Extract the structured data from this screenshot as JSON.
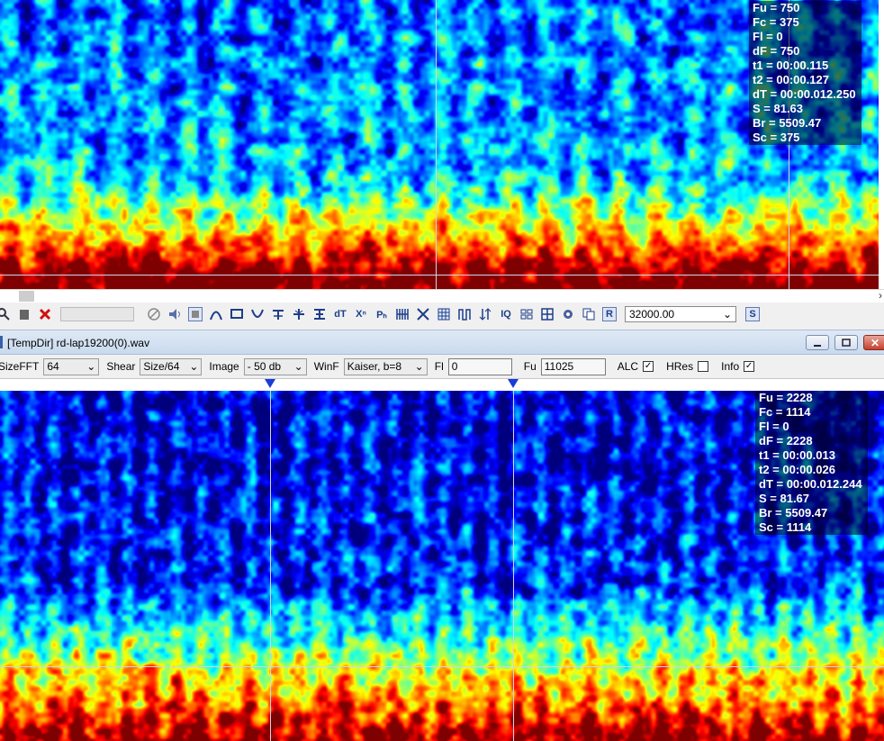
{
  "top_panel": {
    "info": {
      "fu": "Fu = 750",
      "fc": "Fc = 375",
      "fl": "Fl = 0",
      "df": "dF = 750",
      "t1": "t1 = 00:00.115",
      "t2": "t2 = 00:00.127",
      "dt": "dT = 00:00.012.250",
      "s": "S = 81.63",
      "br": "Br = 5509.47",
      "sc": "Sc = 375"
    }
  },
  "toolbar": {
    "icons": [
      "search-icon",
      "delete-icon",
      "cancel-icon",
      "no-icon",
      "speaker-icon",
      "stop-icon",
      "arc-icon",
      "rect-icon",
      "valley-icon",
      "zoom-in-t-icon",
      "zoom-out-t-icon",
      "fit-icon",
      "dt-icon",
      "xn-icon",
      "ph-icon",
      "comb-icon",
      "cross-icon",
      "grid-icon",
      "pulse-icon",
      "filter-icon",
      "iq-icon",
      "pattern-icon",
      "pattern2-icon",
      "settings-icon",
      "copy-icon"
    ],
    "dt_label": "dT",
    "xn_label": "Xⁿ",
    "ph_label": "Pₕ",
    "iq_label": "IQ",
    "r_label": "R",
    "rate_value": "32000.00",
    "s_label": "S"
  },
  "window": {
    "title": "[TempDir] rd-lap19200(0).wav",
    "minimize": "_",
    "maximize": "□",
    "close": "✕"
  },
  "params": {
    "sizefft_label": "SizeFFT",
    "sizefft_value": "64",
    "shear_label": "Shear",
    "shear_value": "Size/64",
    "image_label": "Image",
    "image_value": "- 50 db",
    "winf_label": "WinF",
    "winf_value": "Kaiser, b=8",
    "fl_label": "Fl",
    "fl_value": "0",
    "fu_label": "Fu",
    "fu_value": "11025",
    "alc_label": "ALC",
    "alc_checked": true,
    "hres_label": "HRes",
    "hres_checked": false,
    "info_label": "Info",
    "info_checked": true
  },
  "bottom_panel": {
    "info": {
      "fu": "Fu = 2228",
      "fc": "Fc = 1114",
      "fl": "Fl = 0",
      "df": "dF = 2228",
      "t1": "t1 = 00:00.013",
      "t2": "t2 = 00:00.026",
      "dt": "dT = 00:00.012.244",
      "s": "S = 81.67",
      "br": "Br = 5509.47",
      "sc": "Sc = 1114"
    }
  },
  "colors": {
    "spectro_low": "#000033",
    "spectro_mid": "#00a0ff",
    "spectro_high": "#ff2000",
    "marker": "#1a3cd8"
  }
}
